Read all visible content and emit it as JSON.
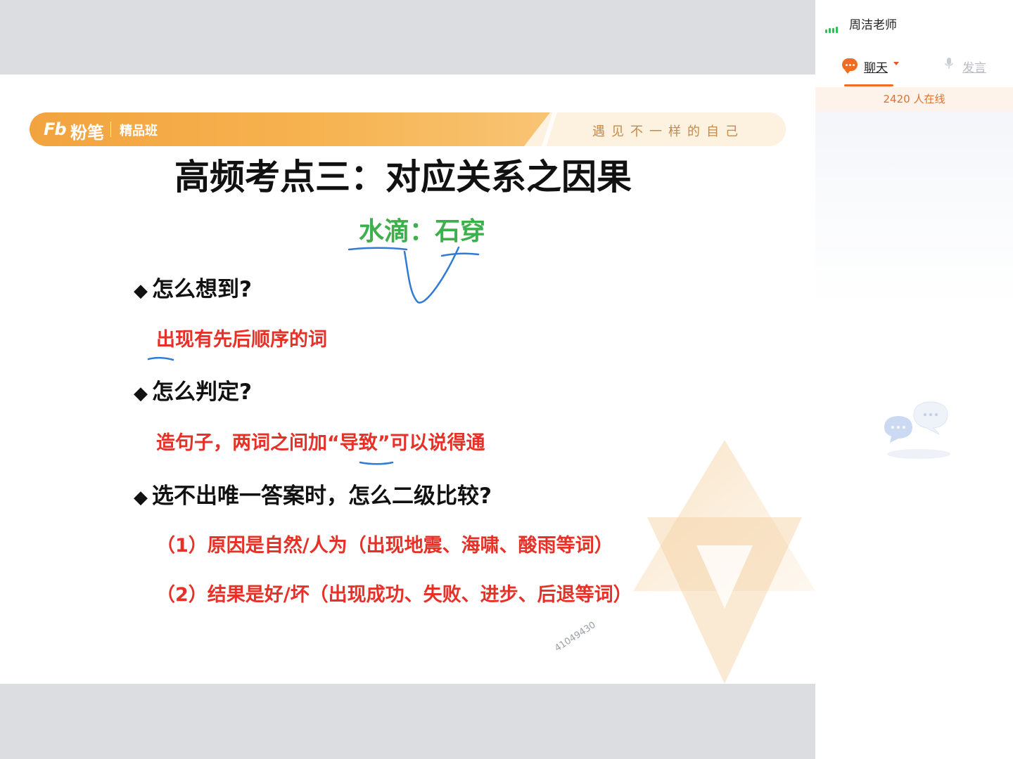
{
  "slide": {
    "brand": {
      "logo_mark": "Fb",
      "logo_name": "粉笔",
      "class_name": "精品班",
      "slogan": "遇见不一样的自己"
    },
    "title": "高频考点三：对应关系之因果",
    "example": "水滴：石穿",
    "sections": [
      {
        "marker": "◆",
        "question": "怎么想到?",
        "answer": "出现有先后顺序的词"
      },
      {
        "marker": "◆",
        "question": "怎么判定?",
        "answer": "造句子，两词之间加“导致”可以说得通"
      },
      {
        "marker": "◆",
        "question": "选不出唯一答案时，怎么二级比较?",
        "points": [
          "（1）原因是自然/人为（出现地震、海啸、酸雨等词）",
          "（2）结果是好/坏（出现成功、失败、进步、后退等词）"
        ]
      }
    ],
    "watermark": "41049430"
  },
  "sidebar": {
    "teacher": "周洁老师",
    "tabs": {
      "chat": "聊天",
      "speak": "发言"
    },
    "online": "2420 人在线"
  },
  "colors": {
    "accent": "#f06c22",
    "answer_red": "#e53127",
    "example_green": "#3eaf4d",
    "ink_blue": "#2f7bd6",
    "banner_orange": "#f2a33f"
  },
  "icons": [
    "signal-icon",
    "chat-bubble-icon",
    "caret-down-icon",
    "microphone-icon",
    "empty-chat-icon"
  ]
}
